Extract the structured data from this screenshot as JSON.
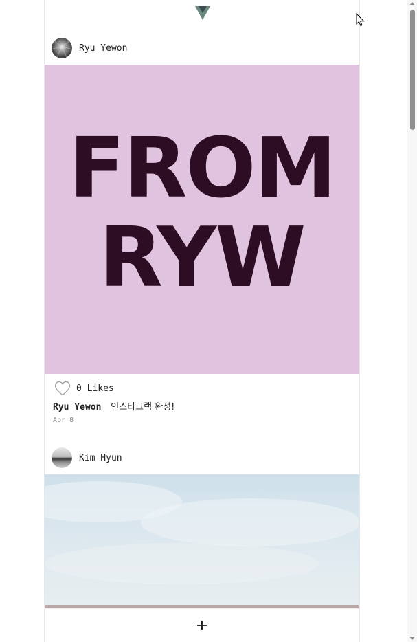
{
  "app": {
    "logo_icon": "vue-logo-icon"
  },
  "posts": [
    {
      "username": "Ryu Yewon",
      "avatar_icon": "avatar-light-burst",
      "image_text_line1": "FROM",
      "image_text_line2": "RYW",
      "image_bg": "#e0c4df",
      "image_text_color": "#2c0d24",
      "likes": "0 Likes",
      "caption_user": "Ryu Yewon",
      "caption_text": "인스타그램 완성!",
      "date": "Apr 8"
    },
    {
      "username": "Kim Hyun",
      "avatar_icon": "avatar-landscape",
      "image_description_color": "#d9e6ee"
    }
  ],
  "bottom_bar": {
    "add_label": "+"
  }
}
